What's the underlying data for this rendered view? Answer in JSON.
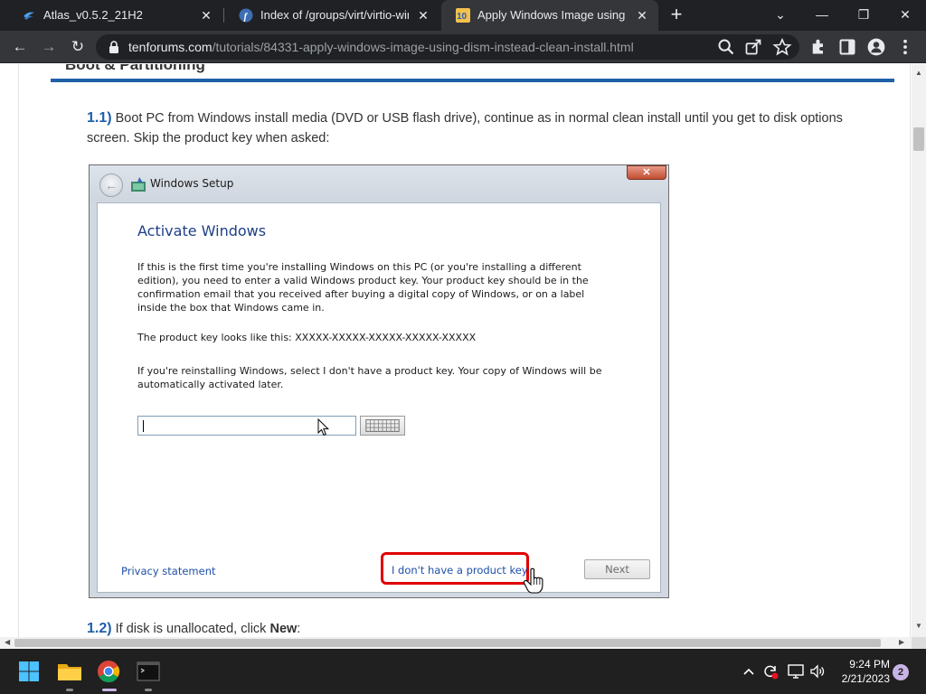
{
  "browser": {
    "tabs": [
      {
        "title": "Atlas_v0.5.2_21H2",
        "icon": "atlas-icon",
        "active": false
      },
      {
        "title": "Index of /groups/virt/virtio-win/d",
        "icon": "fedora-icon",
        "active": false
      },
      {
        "title": "Apply Windows Image using DISM",
        "icon": "tenforums-icon",
        "active": true
      }
    ],
    "tab_close_glyph": "✕",
    "new_tab_glyph": "+",
    "window_controls": {
      "minimize": "—",
      "restore": "❐",
      "close": "✕",
      "tab_search": "⌄"
    },
    "toolbar": {
      "back": "←",
      "forward": "→",
      "reload": "↻",
      "url_domain": "tenforums.com",
      "url_path": "/tutorials/84331-apply-windows-image-using-dism-instead-clean-install.html",
      "icons": [
        "search-icon",
        "share-icon",
        "star-icon",
        "extensions-icon",
        "side-panel-icon",
        "profile-icon",
        "menu-icon"
      ]
    }
  },
  "page": {
    "section_heading": "Boot & Partitioning",
    "step1": {
      "number": "1.1)",
      "text": "Boot PC from Windows install media (DVD or USB flash drive), continue as in normal clean install until you get to disk options screen. Skip the product key when asked:"
    },
    "step2": {
      "number": "1.2)",
      "text_before": "If disk is unallocated, click ",
      "text_bold": "New",
      "text_after": ":"
    }
  },
  "setup_dialog": {
    "window_title": "Windows Setup",
    "close_glyph": "✕",
    "back_glyph": "←",
    "heading": "Activate Windows",
    "paragraph1": "If this is the first time you're installing Windows on this PC (or you're installing a different edition), you need to enter a valid Windows product key. Your product key should be in the confirmation email that you received after buying a digital copy of Windows, or on a label inside the box that Windows came in.",
    "paragraph2": "The product key looks like this: XXXXX-XXXXX-XXXXX-XXXXX-XXXXX",
    "paragraph3": "If you're reinstalling Windows, select I don't have a product key. Your copy of Windows will be automatically activated later.",
    "product_key_value": "",
    "privacy_link": "Privacy statement",
    "no_key_link": "I don't have a product key",
    "next_button": "Next",
    "highlight_color": "#e00000"
  },
  "taskbar": {
    "apps": [
      "windows-start-icon",
      "file-explorer-icon",
      "chrome-icon",
      "terminal-icon"
    ],
    "tray": [
      "chevron-up-icon",
      "sync-alert-icon",
      "display-icon",
      "volume-icon"
    ],
    "time": "9:24 PM",
    "date": "2/21/2023",
    "notification_count": "2"
  },
  "colors": {
    "link_blue": "#1e4fa8",
    "step_number_blue": "#1f5fa8",
    "heading_rule_blue": "#2061a8",
    "chrome_dark": "#202124"
  }
}
